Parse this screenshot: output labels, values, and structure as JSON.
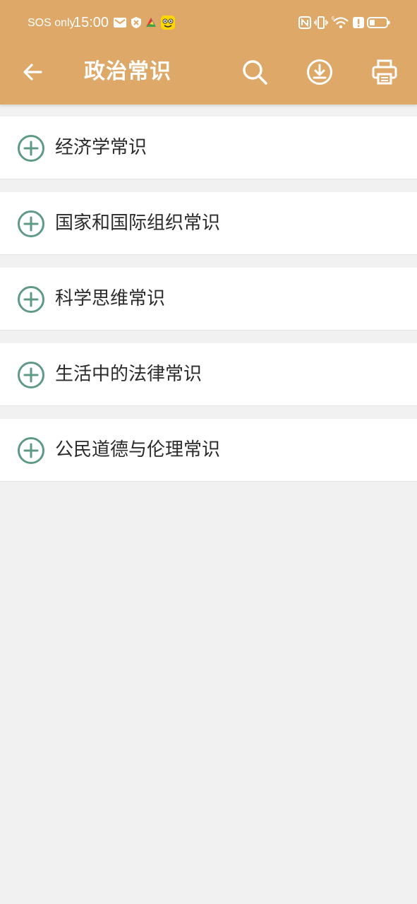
{
  "status_bar": {
    "carrier": "SOS only",
    "time": "15:00",
    "left_icons": [
      "mail-icon",
      "shield-icon",
      "colorful-app-icon",
      "emoji-app-icon"
    ],
    "right_icons": [
      "nfc-icon",
      "vibrate-icon",
      "wifi-icon",
      "alert-icon",
      "battery-icon"
    ],
    "wifi_badge": "6"
  },
  "toolbar": {
    "title": "政治常识",
    "back_icon": "back-arrow-icon",
    "search_icon": "search-icon",
    "download_icon": "download-icon",
    "print_icon": "print-icon"
  },
  "list": {
    "items": [
      {
        "label": "经济学常识",
        "icon": "plus-circle-icon"
      },
      {
        "label": "国家和国际组织常识",
        "icon": "plus-circle-icon"
      },
      {
        "label": "科学思维常识",
        "icon": "plus-circle-icon"
      },
      {
        "label": "生活中的法律常识",
        "icon": "plus-circle-icon"
      },
      {
        "label": "公民道德与伦理常识",
        "icon": "plus-circle-icon"
      }
    ]
  },
  "colors": {
    "appbar": "#dea868",
    "accent_icon": "#5e9a85",
    "background": "#f1f1f1",
    "text": "#2b2b2b"
  }
}
